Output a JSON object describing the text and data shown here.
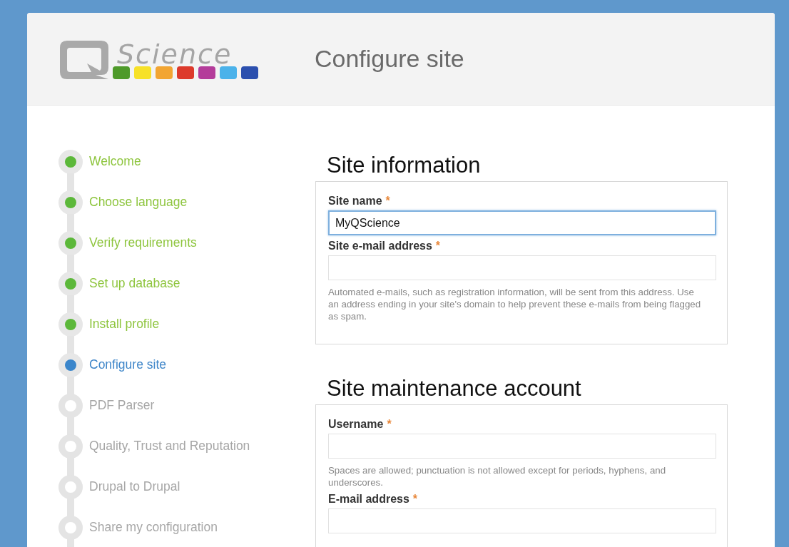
{
  "header": {
    "logo_text": "Science",
    "title": "Configure site"
  },
  "steps": [
    {
      "label": "Welcome",
      "kind": "done"
    },
    {
      "label": "Choose language",
      "kind": "done"
    },
    {
      "label": "Verify requirements",
      "kind": "done"
    },
    {
      "label": "Set up database",
      "kind": "done"
    },
    {
      "label": "Install profile",
      "kind": "done"
    },
    {
      "label": "Configure site",
      "kind": "current"
    },
    {
      "label": "PDF Parser",
      "kind": "pending"
    },
    {
      "label": "Quality, Trust and Reputation",
      "kind": "pending"
    },
    {
      "label": "Drupal to Drupal",
      "kind": "pending"
    },
    {
      "label": "Share my configuration",
      "kind": "pending"
    }
  ],
  "sections": [
    {
      "title": "Site information",
      "fields": [
        {
          "label": "Site name",
          "required_mark": "*",
          "value": "MyQScience",
          "focused": true
        },
        {
          "label": "Site e-mail address",
          "required_mark": "*",
          "focused": false,
          "help": "Automated e-mails, such as registration information, will be sent from this address. Use an address ending in your site's domain to help prevent these e-mails from being flagged as spam."
        }
      ]
    },
    {
      "title": "Site maintenance account",
      "fields": [
        {
          "label": "Username",
          "required_mark": "*",
          "focused": false,
          "help": "Spaces are allowed; punctuation is not allowed except for periods, hyphens, and underscores."
        },
        {
          "label": "E-mail address",
          "required_mark": "*",
          "focused": false
        }
      ]
    }
  ]
}
